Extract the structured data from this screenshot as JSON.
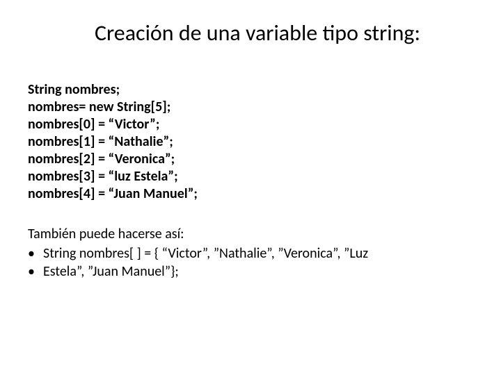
{
  "title": "Creación de una variable tipo string:",
  "code": {
    "line1": "String nombres;",
    "line2": "nombres= new String[5];",
    "line3": "nombres[0] = “Victor”;",
    "line4": "nombres[1] = “Nathalie”;",
    "line5": "nombres[2] = “Veronica”;",
    "line6": "nombres[3] = “luz Estela”;",
    "line7": "nombres[4] = “Juan Manuel”;"
  },
  "also": {
    "intro": "También puede hacerse así:",
    "bullet1": "String nombres[ ] = { “Victor”, ”Nathalie”, ”Veronica”, ”Luz",
    "bullet2": "Estela”, ”Juan Manuel”};"
  }
}
